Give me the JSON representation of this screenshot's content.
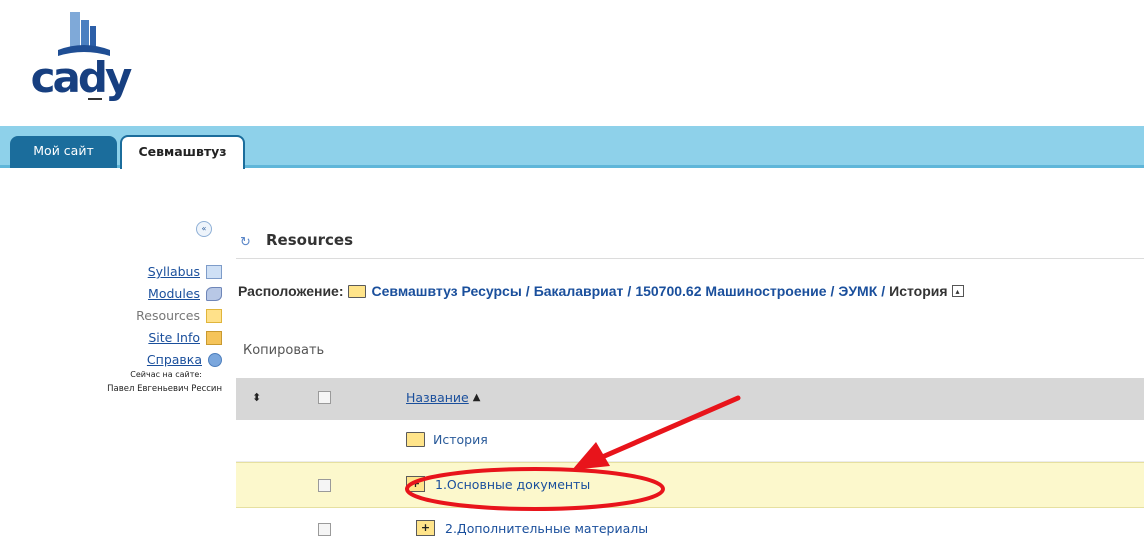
{
  "logo": {
    "text": "cady",
    "icon": "book-logo-icon"
  },
  "tabs": [
    {
      "label": "Мой сайт",
      "active": false
    },
    {
      "label": "Севмашвтуз",
      "active": true
    }
  ],
  "sidebar": {
    "collapse_icon": "double-chevron-left-icon",
    "items": [
      {
        "label": "Syllabus",
        "icon": "syllabus-icon",
        "link": true
      },
      {
        "label": "Modules",
        "icon": "modules-icon",
        "link": true
      },
      {
        "label": "Resources",
        "icon": "folder-icon",
        "link": false
      },
      {
        "label": "Site Info",
        "icon": "site-info-icon",
        "link": true
      },
      {
        "label": "Справка",
        "icon": "help-icon",
        "link": true
      }
    ],
    "online_caption": "Сейчас на сайте:",
    "online_user": "Павел Евгеньевич Рессин"
  },
  "main": {
    "title": "Resources",
    "location": {
      "label": "Расположение:",
      "crumbs": [
        "Севмашвтуз Ресурсы",
        "Бакалавриат",
        "150700.62 Машиностроение",
        "ЭУМК"
      ],
      "separator": "/",
      "current": "История"
    },
    "copy_label": "Копировать",
    "table": {
      "header_name": "Название",
      "rows": [
        {
          "name": "История",
          "type": "parent-folder",
          "checkbox": false,
          "highlight": false
        },
        {
          "name": "1.Основные документы",
          "type": "collapsed-folder",
          "checkbox": true,
          "highlight": true
        },
        {
          "name": "2.Дополнительные материалы",
          "type": "collapsed-folder",
          "checkbox": true,
          "highlight": false
        }
      ]
    }
  },
  "annotation": {
    "color": "#e8141b"
  },
  "colors": {
    "tabbar": "#8ed1ea",
    "tab_active_border": "#1b6d9c",
    "link": "#1a4f9c",
    "highlight_row": "#fcf8cc",
    "header_row": "#d7d7d7"
  }
}
